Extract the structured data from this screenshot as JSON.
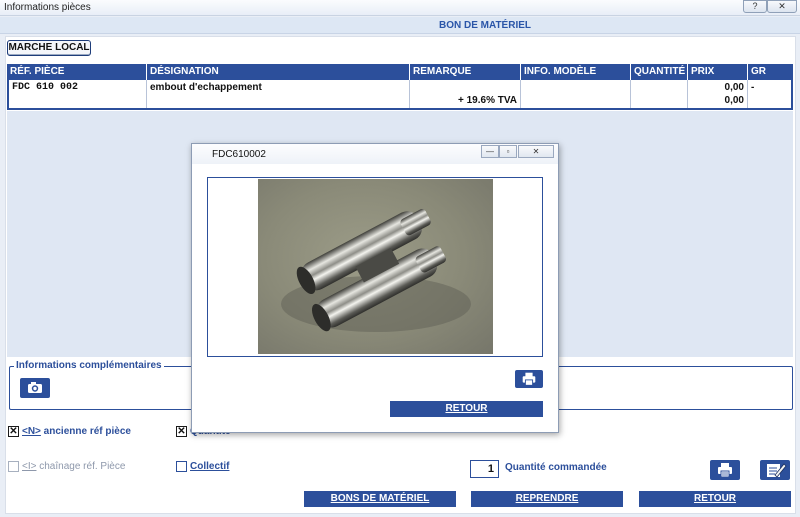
{
  "window": {
    "title": "Informations pièces",
    "help_label": "?",
    "close_label": "✕"
  },
  "header": {
    "title": "BON DE MATÉRIEL"
  },
  "marche_button": "MARCHE LOCAL",
  "table": {
    "columns": [
      "RÉF. PIÈCE",
      "DÉSIGNATION",
      "REMARQUE",
      "INFO. MODÈLE",
      "QUANTITÉ",
      "PRIX",
      "GR"
    ],
    "row": {
      "ref": "FDC 610 002",
      "designation": "embout d'echappement",
      "remarque": "",
      "remarque_tva": "+ 19.6% TVA",
      "info_modele": "",
      "quantite": "",
      "prix": "0,00",
      "prix_tva": "0,00",
      "gr": "-"
    }
  },
  "infos": {
    "legend": "Informations complémentaires"
  },
  "options": {
    "ancienne": {
      "checked": true,
      "shortcut": "<N>",
      "label": " ancienne réf pièce"
    },
    "second": {
      "checked": true,
      "label": "Quantité"
    },
    "chainage": {
      "checked": false,
      "shortcut": "<I>",
      "label": " chaînage réf. Pièce"
    },
    "collectif": {
      "checked": false,
      "label": "Collectif"
    }
  },
  "quantity": {
    "value": "1",
    "label": "Quantité commandée"
  },
  "buttons": {
    "bons": "BONS DE MATÉRIEL",
    "reprendre": "REPRENDRE",
    "retour": "RETOUR"
  },
  "dialog": {
    "title": "FDC610002",
    "retour": "RETOUR"
  },
  "icons": {
    "camera": "camera-icon",
    "print": "printer-icon",
    "edit": "edit-document-icon",
    "minimize": "minimize-icon",
    "restore": "restore-icon",
    "close": "close-icon"
  },
  "colors": {
    "accent": "#2c4f9b",
    "header_text": "#2a55a8",
    "panel": "#dfe7f3"
  }
}
